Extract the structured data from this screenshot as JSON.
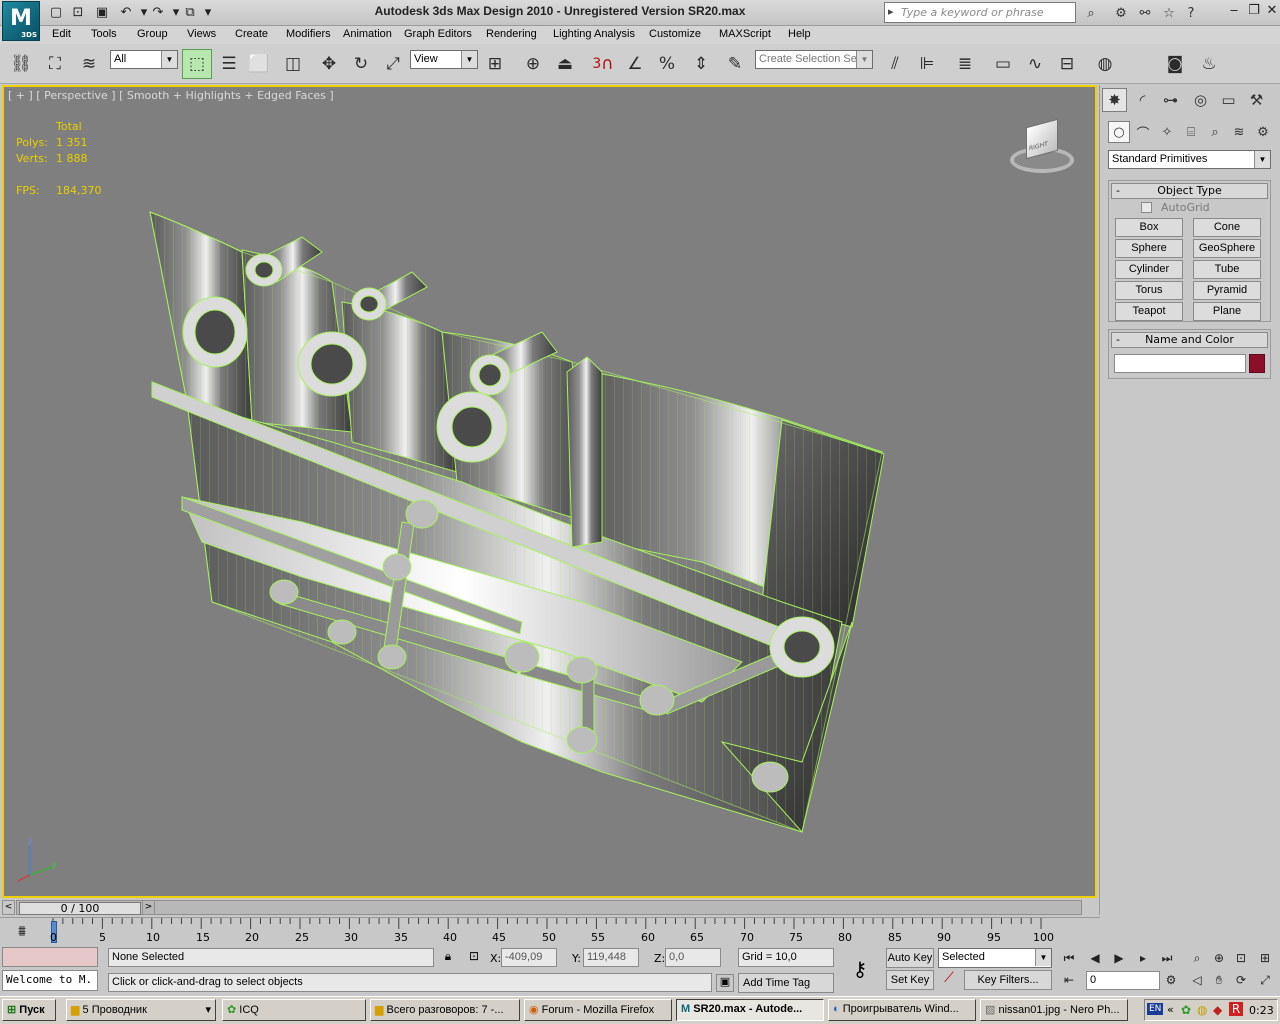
{
  "titlebar": {
    "app_logo": "M",
    "app_logo_sub": "3DS",
    "title": "Autodesk 3ds Max Design 2010  - Unregistered Version    SR20.max",
    "search_placeholder": "Type a keyword or phrase"
  },
  "menu": [
    "Edit",
    "Tools",
    "Group",
    "Views",
    "Create",
    "Modifiers",
    "Animation",
    "Graph Editors",
    "Rendering",
    "Lighting Analysis",
    "Customize",
    "MAXScript",
    "Help"
  ],
  "toolbar": {
    "selection_filter": "All",
    "reference_coord": "View",
    "snap_label": "3",
    "selection_set_placeholder": "Create Selection Se"
  },
  "viewport": {
    "label": "[ + ] [ Perspective ] [ Smooth + Highlights + Edged Faces ]",
    "stats": {
      "total_label": "Total",
      "polys_label": "Polys:",
      "polys_value": "1 351",
      "verts_label": "Verts:",
      "verts_value": "1 888",
      "fps_label": "FPS:",
      "fps_value": "184,370"
    },
    "viewcube_label": "RIGHT"
  },
  "command_panel": {
    "category_dropdown": "Standard Primitives",
    "object_type": {
      "title": "Object Type",
      "autogrid_label": "AutoGrid",
      "buttons": [
        "Box",
        "Cone",
        "Sphere",
        "GeoSphere",
        "Cylinder",
        "Tube",
        "Torus",
        "Pyramid",
        "Teapot",
        "Plane"
      ]
    },
    "name_color": {
      "title": "Name and Color",
      "name_value": "",
      "color": "#8b0f2a"
    }
  },
  "timeline": {
    "slider_label": "0 / 100",
    "ticks": [
      "0",
      "5",
      "10",
      "15",
      "20",
      "25",
      "30",
      "35",
      "40",
      "45",
      "50",
      "55",
      "60",
      "65",
      "70",
      "75",
      "80",
      "85",
      "90",
      "95",
      "100"
    ]
  },
  "status": {
    "listener_text": "Welcome to M.",
    "selection_status": "None Selected",
    "prompt": "Click or click-and-drag to select objects",
    "x_label": "X:",
    "x_value": "-409,09",
    "y_label": "Y:",
    "y_value": "119,448",
    "z_label": "Z:",
    "z_value": "0,0",
    "grid": "Grid = 10,0",
    "add_time_tag": "Add Time Tag",
    "auto_key": "Auto Key",
    "set_key": "Set Key",
    "key_mode": "Selected",
    "key_filters": "Key Filters...",
    "frame_value": "0"
  },
  "taskbar": {
    "start": "Пуск",
    "tasks": [
      "5 Проводник",
      "ICQ",
      "Всего разговоров: 7 -...",
      "Forum - Mozilla Firefox",
      "SR20.max - Autode...",
      "Проигрыватель Wind...",
      "nissan01.jpg - Nero Ph..."
    ],
    "lang": "EN",
    "clock": "0:23"
  }
}
